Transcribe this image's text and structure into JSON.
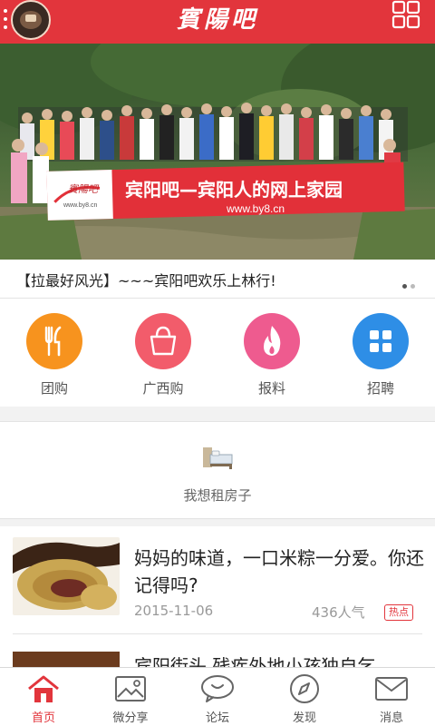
{
  "header": {
    "brand": "賓陽吧",
    "menu_icon": "more-vert-icon",
    "grid_icon": "grid-icon",
    "accent_color": "#e2353c"
  },
  "banner": {
    "sign_text": "宾阳吧—宾阳人的网上家园",
    "sign_url": "www.by8.cn",
    "sign_logo": "賓陽吧",
    "sign_logo_url": "www.by8.cn"
  },
  "carousel": {
    "caption": "【拉最好风光】~~~宾阳吧欢乐上林行!",
    "page_count": 2,
    "active_page": 1
  },
  "categories": [
    {
      "label": "团购",
      "icon": "fork-knife-icon",
      "color": "#f7931e"
    },
    {
      "label": "广西购",
      "icon": "shopping-bag-icon",
      "color": "#f25c6b"
    },
    {
      "label": "报料",
      "icon": "flame-icon",
      "color": "#ee5b8f"
    },
    {
      "label": "招聘",
      "icon": "apps-grid-icon",
      "color": "#2e8ee6"
    }
  ],
  "rent": {
    "label": "我想租房子",
    "icon": "bed-icon"
  },
  "news": [
    {
      "title": "妈妈的味道，一口米粽一分爱。你还记得吗?",
      "date": "2015-11-06",
      "views": "436人气",
      "badge": "热点"
    },
    {
      "title": "宾阳街头 残疾外地小孩独自乞"
    }
  ],
  "tabbar": [
    {
      "label": "首页",
      "icon": "home-icon",
      "active": true
    },
    {
      "label": "微分享",
      "icon": "image-icon",
      "active": false
    },
    {
      "label": "论坛",
      "icon": "chat-bubble-icon",
      "active": false
    },
    {
      "label": "发现",
      "icon": "compass-icon",
      "active": false
    },
    {
      "label": "消息",
      "icon": "mail-icon",
      "active": false
    }
  ]
}
